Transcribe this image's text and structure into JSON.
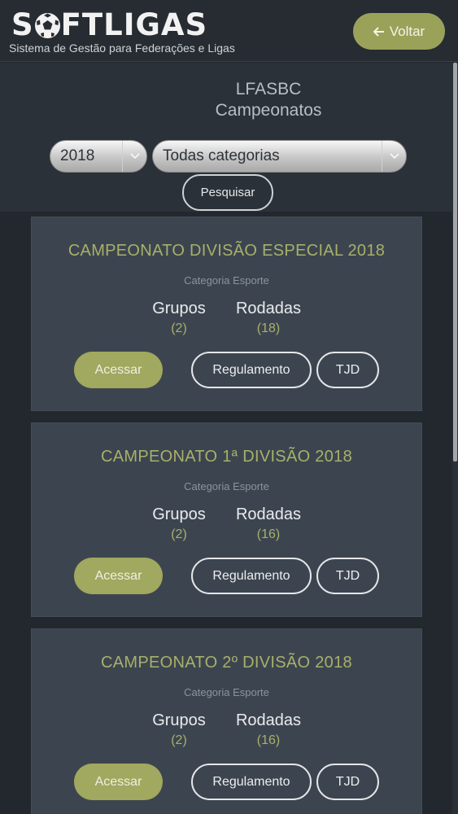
{
  "header": {
    "logo_part1": "S",
    "logo_part2": "FTLIGAS",
    "logo_ball_icon": "soccer-ball-icon",
    "subtitle": "Sistema de Gestão para Federações e Ligas",
    "back_label": "Voltar",
    "back_icon": "arrow-left-icon",
    "accent_color": "#9aa25a"
  },
  "page": {
    "org": "LFASBC",
    "title": "Campeonatos"
  },
  "filters": {
    "year": "2018",
    "category": "Todas categorias",
    "search_label": "Pesquisar"
  },
  "championships": [
    {
      "title": "CAMPEONATO DIVISÃO ESPECIAL 2018",
      "category": "Categoria Esporte",
      "groups_label": "Grupos",
      "groups_value": "(2)",
      "rounds_label": "Rodadas",
      "rounds_value": "(18)",
      "access_label": "Acessar",
      "regulation_label": "Regulamento",
      "tjd_label": "TJD"
    },
    {
      "title": "CAMPEONATO 1ª DIVISÃO 2018",
      "category": "Categoria Esporte",
      "groups_label": "Grupos",
      "groups_value": "(2)",
      "rounds_label": "Rodadas",
      "rounds_value": "(16)",
      "access_label": "Acessar",
      "regulation_label": "Regulamento",
      "tjd_label": "TJD"
    },
    {
      "title": "CAMPEONATO 2º DIVISÃO 2018",
      "category": "Categoria Esporte",
      "groups_label": "Grupos",
      "groups_value": "(2)",
      "rounds_label": "Rodadas",
      "rounds_value": "(16)",
      "access_label": "Acessar",
      "regulation_label": "Regulamento",
      "tjd_label": "TJD"
    }
  ]
}
